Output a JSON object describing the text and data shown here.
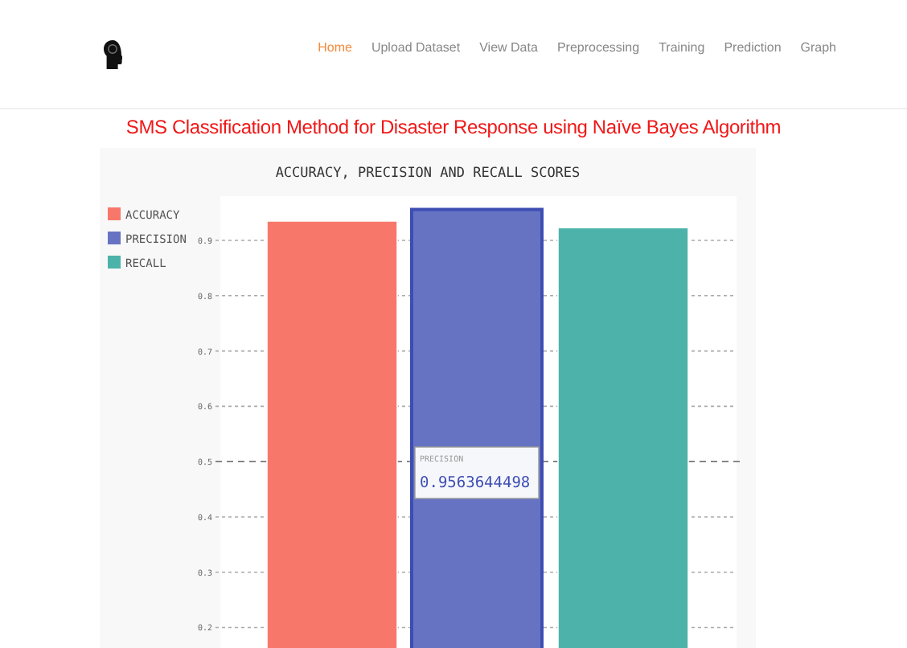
{
  "nav": {
    "items": [
      {
        "label": "Home",
        "selected": true
      },
      {
        "label": "Upload Dataset",
        "selected": false
      },
      {
        "label": "View Data",
        "selected": false
      },
      {
        "label": "Preprocessing",
        "selected": false
      },
      {
        "label": "Training",
        "selected": false
      },
      {
        "label": "Prediction",
        "selected": false
      },
      {
        "label": "Graph",
        "selected": false
      }
    ]
  },
  "page_title": "SMS Classification Method for Disaster Response using Naïve Bayes Algorithm",
  "chart": {
    "chart_data": {
      "type": "bar",
      "title": "ACCURACY, PRECISION AND RECALL SCORES",
      "series": [
        {
          "name": "ACCURACY",
          "color": "#f7786b",
          "values": [
            0.935
          ]
        },
        {
          "name": "PRECISION",
          "color": "#6673c2",
          "values": [
            0.956
          ]
        },
        {
          "name": "RECALL",
          "color": "#4db3aa",
          "values": [
            0.923
          ]
        }
      ],
      "ylim": [
        0.16,
        0.98
      ],
      "grid": true,
      "legend": true,
      "ref_lines": [
        {
          "axis": "y",
          "value": 0.5
        }
      ],
      "yticks": [
        0.2,
        0.3,
        0.4,
        0.5,
        0.6,
        0.7,
        0.8,
        0.9
      ]
    },
    "highlighted_series": [
      false,
      true,
      false
    ],
    "tooltip": {
      "label": "PRECISION",
      "value": "0.9563644498"
    }
  }
}
